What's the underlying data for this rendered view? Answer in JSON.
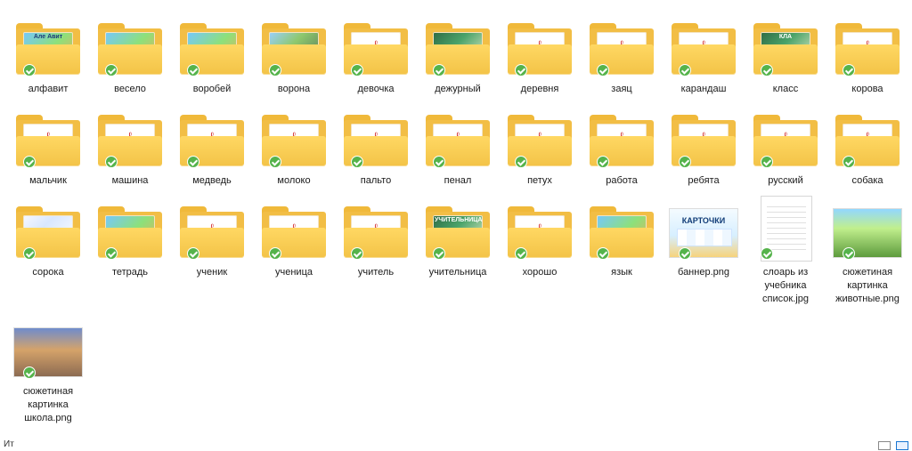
{
  "items": [
    {
      "label": "алфавит",
      "kind": "folder",
      "preview": "preview",
      "preview_text": "Але Авит"
    },
    {
      "label": "весело",
      "kind": "folder",
      "preview": "preview"
    },
    {
      "label": "воробей",
      "kind": "folder",
      "preview": "preview"
    },
    {
      "label": "ворона",
      "kind": "folder",
      "preview": "alt"
    },
    {
      "label": "девочка",
      "kind": "folder",
      "preview": "pdf"
    },
    {
      "label": "дежурный",
      "kind": "folder",
      "preview": "green"
    },
    {
      "label": "деревня",
      "kind": "folder",
      "preview": "pdf"
    },
    {
      "label": "заяц",
      "kind": "folder",
      "preview": "pdf"
    },
    {
      "label": "карандаш",
      "kind": "folder",
      "preview": "pdf"
    },
    {
      "label": "класс",
      "kind": "folder",
      "preview": "green",
      "preview_text": "КЛА"
    },
    {
      "label": "корова",
      "kind": "folder",
      "preview": "pdf"
    },
    {
      "label": "мальчик",
      "kind": "folder",
      "preview": "pdf"
    },
    {
      "label": "машина",
      "kind": "folder",
      "preview": "pdf"
    },
    {
      "label": "медведь",
      "kind": "folder",
      "preview": "pdf"
    },
    {
      "label": "молоко",
      "kind": "folder",
      "preview": "pdf"
    },
    {
      "label": "пальто",
      "kind": "folder",
      "preview": "pdf"
    },
    {
      "label": "пенал",
      "kind": "folder",
      "preview": "pdf"
    },
    {
      "label": "петух",
      "kind": "folder",
      "preview": "pdf"
    },
    {
      "label": "работа",
      "kind": "folder",
      "preview": "pdf"
    },
    {
      "label": "ребята",
      "kind": "folder",
      "preview": "pdf"
    },
    {
      "label": "русский",
      "kind": "folder",
      "preview": "pdf"
    },
    {
      "label": "собака",
      "kind": "folder",
      "preview": "pdf"
    },
    {
      "label": "сорока",
      "kind": "folder",
      "preview": "light"
    },
    {
      "label": "тетрадь",
      "kind": "folder",
      "preview": "preview"
    },
    {
      "label": "ученик",
      "kind": "folder",
      "preview": "pdf"
    },
    {
      "label": "ученица",
      "kind": "folder",
      "preview": "pdf"
    },
    {
      "label": "учитель",
      "kind": "folder",
      "preview": "pdf"
    },
    {
      "label": "учительница",
      "kind": "folder",
      "preview": "green",
      "preview_text": "УЧИТЕЛЬНИЦА"
    },
    {
      "label": "хорошо",
      "kind": "folder",
      "preview": "pdf"
    },
    {
      "label": "язык",
      "kind": "folder",
      "preview": "preview"
    },
    {
      "label": "баннер.png",
      "kind": "banner",
      "preview_text": "КАРТОЧКИ"
    },
    {
      "label": "слоарь из учебника список.jpg",
      "kind": "list"
    },
    {
      "label": "сюжетиная картинка животные.png",
      "kind": "animals"
    },
    {
      "label": "сюжетиная картинка школа.png",
      "kind": "school"
    }
  ],
  "status": {
    "left_text": "Ит"
  }
}
